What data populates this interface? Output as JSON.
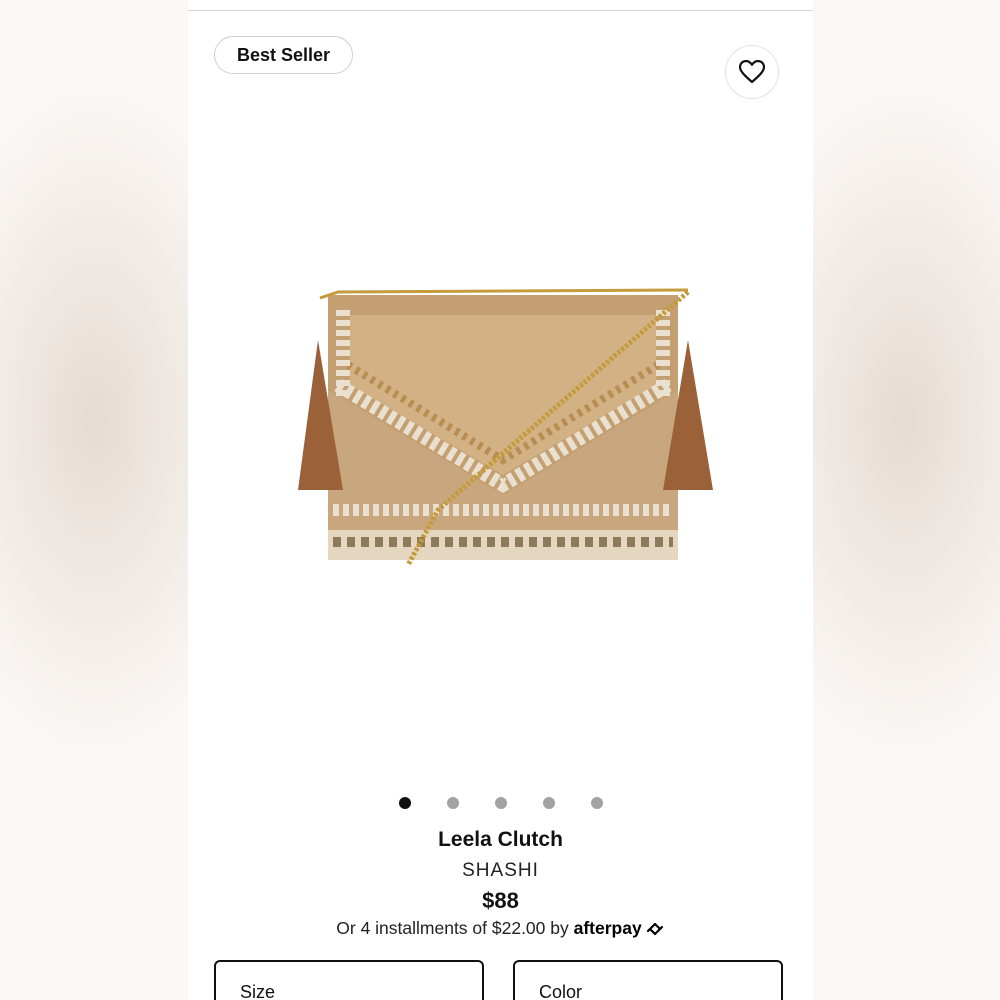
{
  "badge": {
    "label": "Best Seller"
  },
  "favorite": {
    "icon": "heart-outline-icon"
  },
  "product": {
    "image": "beaded-jute-clutch-with-tassels-and-gold-chain",
    "name": "Leela Clutch",
    "brand": "SHASHI",
    "price": "$88"
  },
  "carousel": {
    "count": 5,
    "active_index": 0
  },
  "installments": {
    "text": "Or 4 installments of $22.00 by",
    "provider": "afterpay"
  },
  "options": {
    "size_label": "Size",
    "color_label": "Color"
  },
  "colors": {
    "text": "#111111",
    "dot_inactive": "#a3a3a3",
    "dot_active": "#111111",
    "jute": "#c9a77e",
    "tassel": "#9b6239",
    "chain": "#c49a3a"
  }
}
